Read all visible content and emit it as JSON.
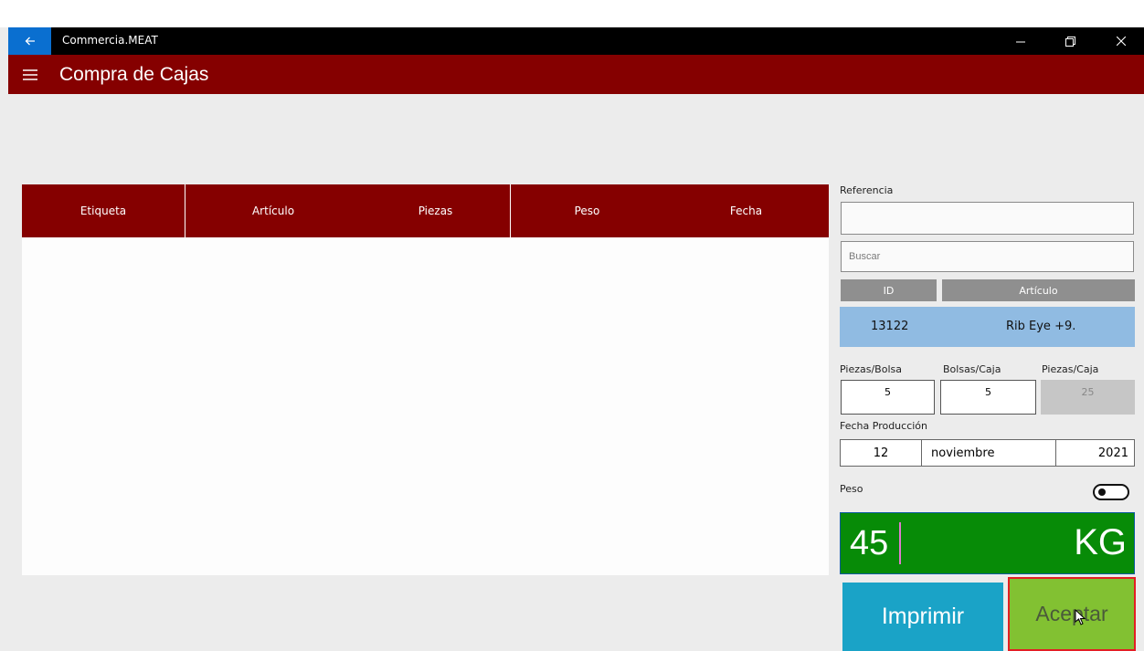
{
  "window": {
    "app_title": "Commercia.MEAT",
    "back_icon": "arrow-left-icon",
    "minimize_icon": "minimize-icon",
    "maximize_icon": "restore-icon",
    "close_icon": "close-icon"
  },
  "header": {
    "menu_icon": "hamburger-icon",
    "page_title": "Compra de Cajas"
  },
  "table": {
    "columns": [
      "Etiqueta",
      "Artículo",
      "Piezas",
      "Peso",
      "Fecha"
    ],
    "rows": []
  },
  "side": {
    "referencia_label": "Referencia",
    "referencia_value": "",
    "search_placeholder": "Buscar",
    "grid_headers": {
      "id": "ID",
      "articulo": "Artículo"
    },
    "result": {
      "id": "13122",
      "articulo": "Rib Eye +9."
    },
    "piezas_bolsa_label": "Piezas/Bolsa",
    "piezas_bolsa_value": "5",
    "bolsas_caja_label": "Bolsas/Caja",
    "bolsas_caja_value": "5",
    "piezas_caja_label": "Piezas/Caja",
    "piezas_caja_value": "25",
    "fecha_label": "Fecha Producción",
    "fecha": {
      "day": "12",
      "month": "noviembre",
      "year": "2021"
    },
    "peso_label": "Peso",
    "peso_toggle_on": false,
    "weight_value": "45",
    "weight_unit": "KG"
  },
  "actions": {
    "print_label": "Imprimir",
    "accept_label": "Aceptar"
  },
  "colors": {
    "header": "#850000",
    "weight_panel": "#078b07",
    "print_button": "#1aa3c7",
    "accept_button": "#82c132",
    "result_row": "#90bbe2"
  }
}
